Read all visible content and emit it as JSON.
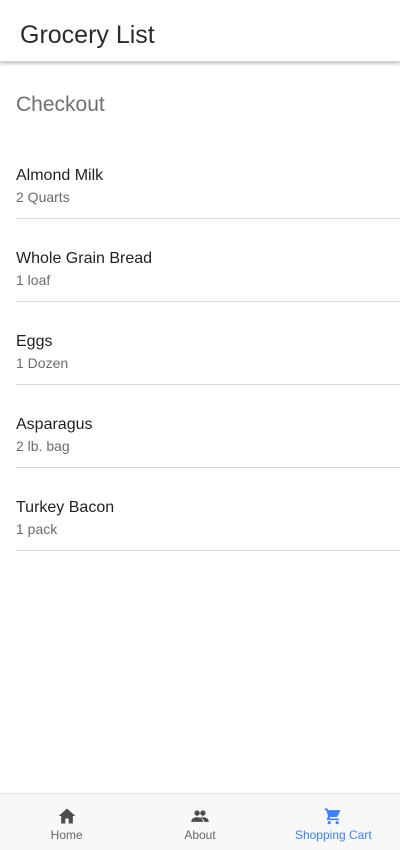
{
  "header": {
    "title": "Grocery List"
  },
  "section": {
    "title": "Checkout"
  },
  "items": [
    {
      "name": "Almond Milk",
      "quantity": "2 Quarts"
    },
    {
      "name": "Whole Grain Bread",
      "quantity": "1 loaf"
    },
    {
      "name": "Eggs",
      "quantity": "1 Dozen"
    },
    {
      "name": "Asparagus",
      "quantity": "2 lb. bag"
    },
    {
      "name": "Turkey Bacon",
      "quantity": "1 pack"
    }
  ],
  "tabs": [
    {
      "label": "Home",
      "icon": "home-icon",
      "active": false
    },
    {
      "label": "About",
      "icon": "people-icon",
      "active": false
    },
    {
      "label": "Shopping Cart",
      "icon": "cart-icon",
      "active": true
    }
  ],
  "colors": {
    "accent": "#3880ff",
    "tab_inactive": "#666666",
    "divider": "#d9d9d9"
  }
}
